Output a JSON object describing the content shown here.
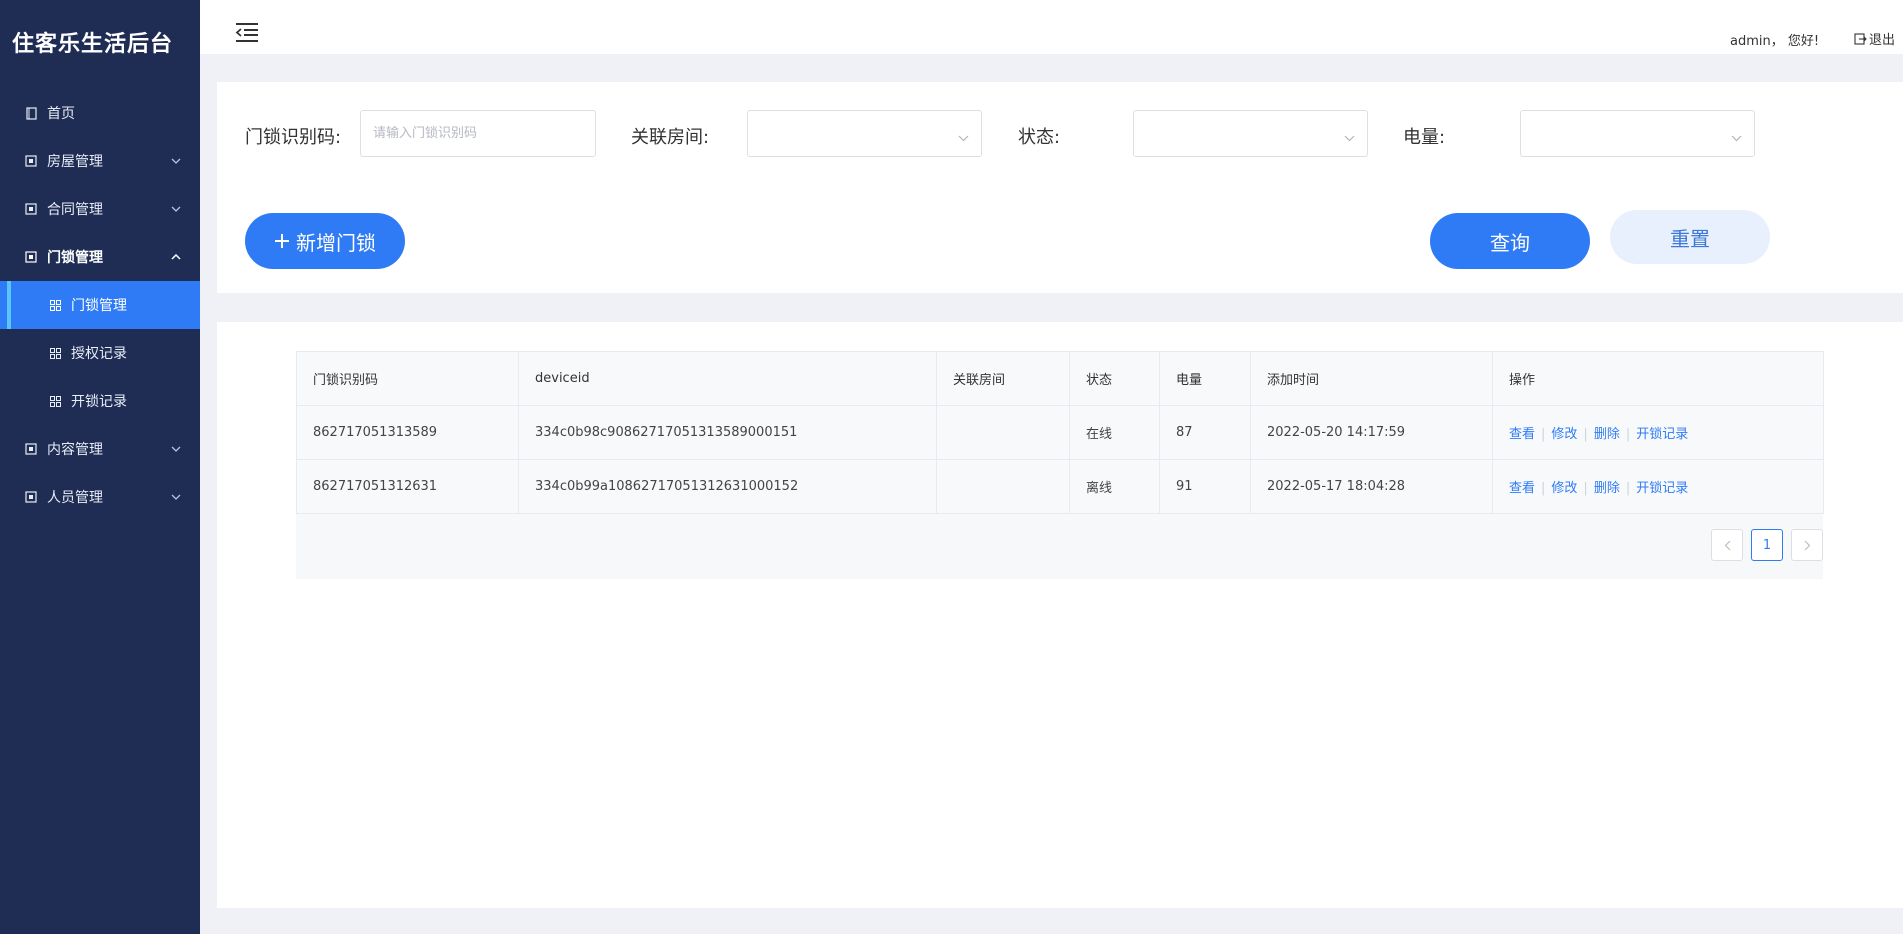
{
  "app": {
    "title": "住客乐生活后台"
  },
  "sidebar": {
    "items": [
      {
        "label": "首页",
        "icon": "doc-icon",
        "has_arrow": false
      },
      {
        "label": "房屋管理",
        "icon": "frame-icon",
        "has_arrow": true
      },
      {
        "label": "合同管理",
        "icon": "frame-icon",
        "has_arrow": true
      },
      {
        "label": "门锁管理",
        "icon": "frame-icon",
        "has_arrow": true,
        "expanded": true
      },
      {
        "label": "内容管理",
        "icon": "frame-icon",
        "has_arrow": true
      },
      {
        "label": "人员管理",
        "icon": "frame-icon",
        "has_arrow": true
      }
    ],
    "subitems": [
      {
        "label": "门锁管理",
        "icon": "grid-icon",
        "selected": true
      },
      {
        "label": "授权记录",
        "icon": "grid-icon",
        "selected": false
      },
      {
        "label": "开锁记录",
        "icon": "grid-icon",
        "selected": false
      }
    ]
  },
  "header": {
    "greeting": "admin， 您好!",
    "logout": "退出"
  },
  "filters": {
    "lock_code_label": "门锁识别码:",
    "lock_code_placeholder": "请输入门锁识别码",
    "room_label": "关联房间:",
    "room_value": "",
    "status_label": "状态:",
    "status_value": "",
    "battery_label": "电量:",
    "battery_value": ""
  },
  "buttons": {
    "add": "新增门锁",
    "query": "查询",
    "reset": "重置"
  },
  "table": {
    "columns": [
      "门锁识别码",
      "deviceid",
      "关联房间",
      "状态",
      "电量",
      "添加时间",
      "操作"
    ],
    "rows": [
      {
        "code": "862717051313589",
        "deviceid": "334c0b98c90862717051313589000151",
        "room": "",
        "status": "在线",
        "battery": "87",
        "added": "2022-05-20 14:17:59"
      },
      {
        "code": "862717051312631",
        "deviceid": "334c0b99a10862717051312631000152",
        "room": "",
        "status": "离线",
        "battery": "91",
        "added": "2022-05-17 18:04:28"
      }
    ],
    "actions": [
      "查看",
      "修改",
      "删除",
      "开锁记录"
    ]
  },
  "pagination": {
    "current": "1"
  },
  "colors": {
    "sidebar_bg": "#1f2d55",
    "accent": "#2f7bf6",
    "reset_bg": "#e8f0fd"
  }
}
